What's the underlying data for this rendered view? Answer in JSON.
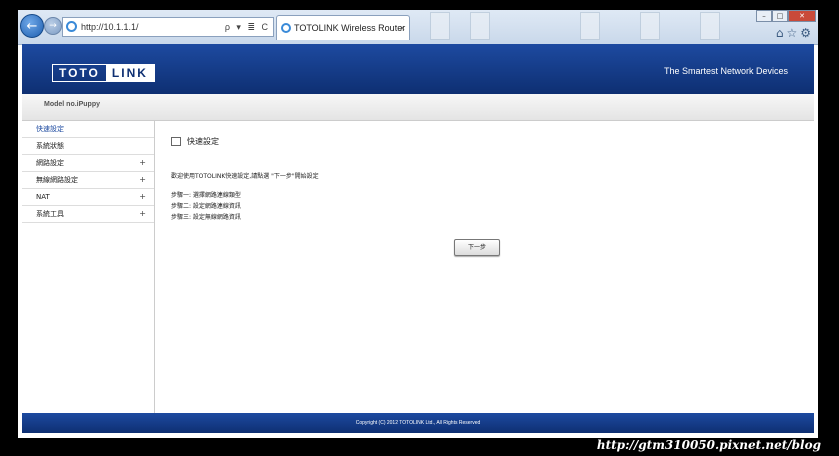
{
  "browser": {
    "address": "http://10.1.1.1/",
    "tab_title": "TOTOLINK Wireless Router",
    "tab_close": "×",
    "addr_controls": "ρ ▾ ≣ C",
    "icons": [
      "back-icon",
      "forward-icon",
      "home-icon",
      "star-icon",
      "gear-icon"
    ]
  },
  "header": {
    "logo_left": "TOTO",
    "logo_right": "LINK",
    "tagline": "The Smartest Network Devices"
  },
  "model": "Model no.iPuppy",
  "sidebar": {
    "items": [
      {
        "label": "快速設定",
        "expandable": false,
        "active": true
      },
      {
        "label": "系統狀態",
        "expandable": false,
        "active": false
      },
      {
        "label": "網路設定",
        "expandable": true,
        "active": false
      },
      {
        "label": "無線網路設定",
        "expandable": true,
        "active": false
      },
      {
        "label": "NAT",
        "expandable": true,
        "active": false
      },
      {
        "label": "系統工具",
        "expandable": true,
        "active": false
      }
    ],
    "plus": "+"
  },
  "main": {
    "title": "快速設定",
    "intro": "歡迎使用TOTOLINK快速設定,請點選 \"下一步\"開始設定",
    "steps": [
      "步驟一: 選擇網路連線類型",
      "步驟二: 設定網路連線資訊",
      "步驟三: 設定無線網路資訊"
    ],
    "next_button": "下一步"
  },
  "footer": {
    "copyright": "Copyright (C) 2012 TOTOLINK Ltd.,   All Rights Reserved"
  },
  "watermark": "http://gtm310050.pixnet.net/blog",
  "colors": {
    "brand_blue": "#1d4aa0",
    "brand_dark": "#0e2f72"
  }
}
